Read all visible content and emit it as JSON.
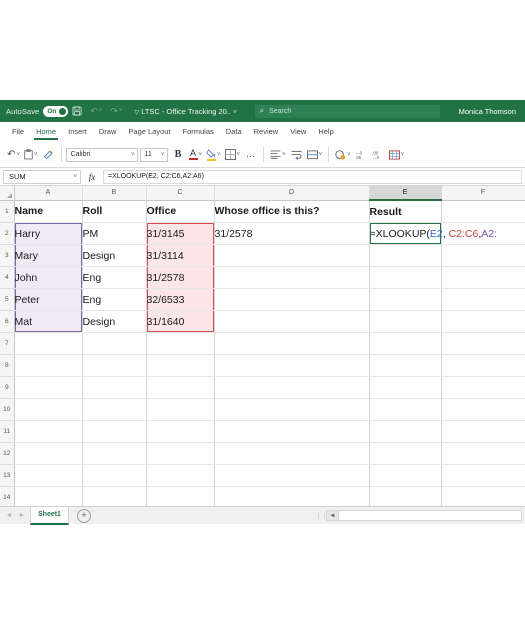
{
  "titlebar": {
    "autosave_label": "AutoSave",
    "autosave_state": "On",
    "save_icon": "save-icon",
    "undo_icon": "undo-icon",
    "redo_icon": "redo-icon",
    "doc_title": "LTSC - Office Tracking 20..",
    "search_placeholder": "Search",
    "search_icon": "search-icon",
    "user_name": "Monica Thomson",
    "accent_color": "#217346"
  },
  "ribbon": {
    "tabs": [
      {
        "label": "File",
        "active": false
      },
      {
        "label": "Home",
        "active": true
      },
      {
        "label": "Insert",
        "active": false
      },
      {
        "label": "Draw",
        "active": false
      },
      {
        "label": "Page Layout",
        "active": false
      },
      {
        "label": "Formulas",
        "active": false
      },
      {
        "label": "Data",
        "active": false
      },
      {
        "label": "Review",
        "active": false
      },
      {
        "label": "View",
        "active": false
      },
      {
        "label": "Help",
        "active": false
      }
    ],
    "toolbar": {
      "undo": "↶",
      "paste": "paste-icon",
      "format_painter": "format-painter-icon",
      "font_name": "Calibri",
      "font_size": "11",
      "bold": "B",
      "font_color": "A",
      "font_color_swatch": "#cc2b2b",
      "fill_color_swatch": "#f2c811",
      "borders": "borders-icon",
      "more": "…",
      "align": "align-icon",
      "wrap_text": "wrap-text-icon",
      "merge": "merge-cells-icon",
      "number_format": "number-format-icon",
      "increase_decimal": "increase-decimal-icon",
      "decrease_decimal": "decrease-decimal-icon",
      "conditional_format": "conditional-format-icon"
    }
  },
  "formula_bar": {
    "name_box_value": "SUM",
    "fx_label": "fx",
    "formula_value": "=XLOOKUP(E2, C2:C6,A2:A6)"
  },
  "grid": {
    "columns": [
      "A",
      "B",
      "C",
      "D",
      "E",
      "F"
    ],
    "active_column": "E",
    "rows": [
      "1",
      "2",
      "3",
      "4",
      "5",
      "6",
      "7",
      "8",
      "9",
      "10",
      "11",
      "12",
      "13",
      "14"
    ],
    "cells": {
      "A1": "Name",
      "B1": "Roll",
      "C1": "Office",
      "D1": "Whose office is this?",
      "E1": "Result",
      "A2": "Harry",
      "B2": "PM",
      "C2": "31/3145",
      "D2": "31/2578",
      "A3": "Mary",
      "B3": "Design",
      "C3": "31/3114",
      "A4": "John",
      "B4": "Eng",
      "C4": "31/2578",
      "A5": "Peter",
      "B5": "Eng",
      "C5": "32/6533",
      "A6": "Mat",
      "B6": "Design",
      "C6": "31/1640"
    },
    "editing_cell": {
      "ref": "E2",
      "segments": [
        {
          "text": "=XLOOKUP(",
          "color": "#1a1a1a"
        },
        {
          "text": "E2",
          "color": "#2b6cd4"
        },
        {
          "text": ", ",
          "color": "#1a1a1a"
        },
        {
          "text": "C2:C6",
          "color": "#cf3a3a"
        },
        {
          "text": ",",
          "color": "#1a1a1a"
        },
        {
          "text": "A2:",
          "color": "#7a4fb5"
        }
      ],
      "part_black_1": "=XLOOKUP(",
      "part_blue": "E2",
      "part_comma_1": ", ",
      "part_red": "C2:C6",
      "part_comma_2": ",",
      "part_purple": "A2:"
    },
    "highlight_ranges": [
      {
        "range": "A2:A6",
        "fill": "#efeaf5",
        "border": "#7a6aa8",
        "name": "return-array-highlight"
      },
      {
        "range": "C2:C6",
        "fill": "#fae6e6",
        "border": "#d94b4b",
        "name": "lookup-array-highlight"
      }
    ]
  },
  "statusbar": {
    "prev_sheet_icon": "chevron-left-icon",
    "next_sheet_icon": "chevron-right-icon",
    "sheet_tab": "Sheet1",
    "add_sheet_icon": "plus-icon",
    "split_handle": "split-handle-icon",
    "scroll_left_icon": "scroll-left-arrow"
  }
}
